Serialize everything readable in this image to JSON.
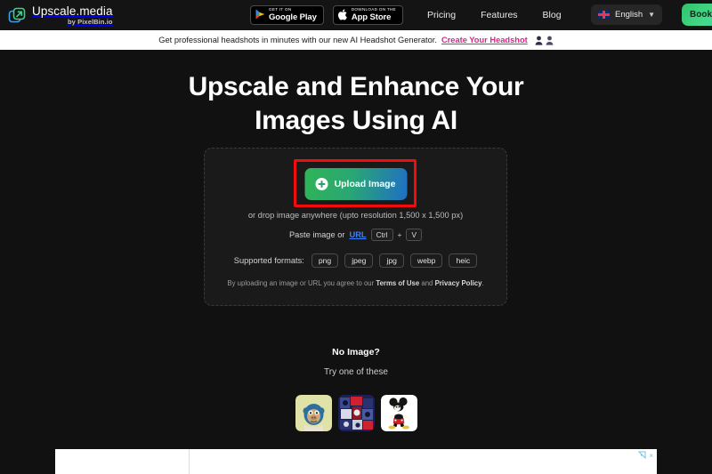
{
  "brand": {
    "title": "Upscale.media",
    "subtitle": "by PixelBin.io",
    "logo_icon": "upscale-arrow-icon"
  },
  "navbar": {
    "store_badges": [
      {
        "top": "GET IT ON",
        "bottom": "Google Play",
        "icon": "google-play-icon"
      },
      {
        "top": "Download on the",
        "bottom": "App Store",
        "icon": "apple-icon"
      }
    ],
    "links": [
      {
        "label": "Pricing"
      },
      {
        "label": "Features"
      },
      {
        "label": "Blog"
      }
    ],
    "language": {
      "label": "English",
      "flag_icon": "uk-flag-icon",
      "chevron_icon": "chevron-down-icon"
    },
    "cta": {
      "label": "Book a"
    }
  },
  "announcement": {
    "text": "Get professional headshots in minutes with our new AI Headshot Generator.",
    "link_label": "Create Your Headshot",
    "link_color": "#e0218a",
    "person_icons": [
      "person-icon",
      "person-icon"
    ]
  },
  "hero": {
    "title_line1": "Upscale and Enhance Your",
    "title_line2": "Images Using AI"
  },
  "upload": {
    "button_label": "Upload Image",
    "button_icon": "plus-circle-icon",
    "drop_text": "or drop image anywhere (upto resolution 1,500 x 1,500 px)",
    "paste_label": "Paste image or",
    "url_link": "URL",
    "shortcut": {
      "key1": "Ctrl",
      "separator": "+",
      "key2": "V"
    },
    "formats_label": "Supported formats:",
    "formats": [
      "png",
      "jpeg",
      "jpg",
      "webp",
      "heic"
    ],
    "terms_prefix": "By uploading an image or URL you agree to our ",
    "terms_link": "Terms of Use",
    "terms_middle": " and ",
    "privacy_link": "Privacy Policy",
    "terms_suffix": ".",
    "highlight_color": "#f40b0b"
  },
  "samples": {
    "heading": "No Image?",
    "subheading": "Try one of these",
    "items": [
      {
        "name": "sample-ape-thumbnail"
      },
      {
        "name": "sample-collage-thumbnail"
      },
      {
        "name": "sample-mickey-thumbnail"
      }
    ]
  },
  "ad": {
    "adchoices_icon": "adchoices-icon",
    "close_label": "×"
  }
}
